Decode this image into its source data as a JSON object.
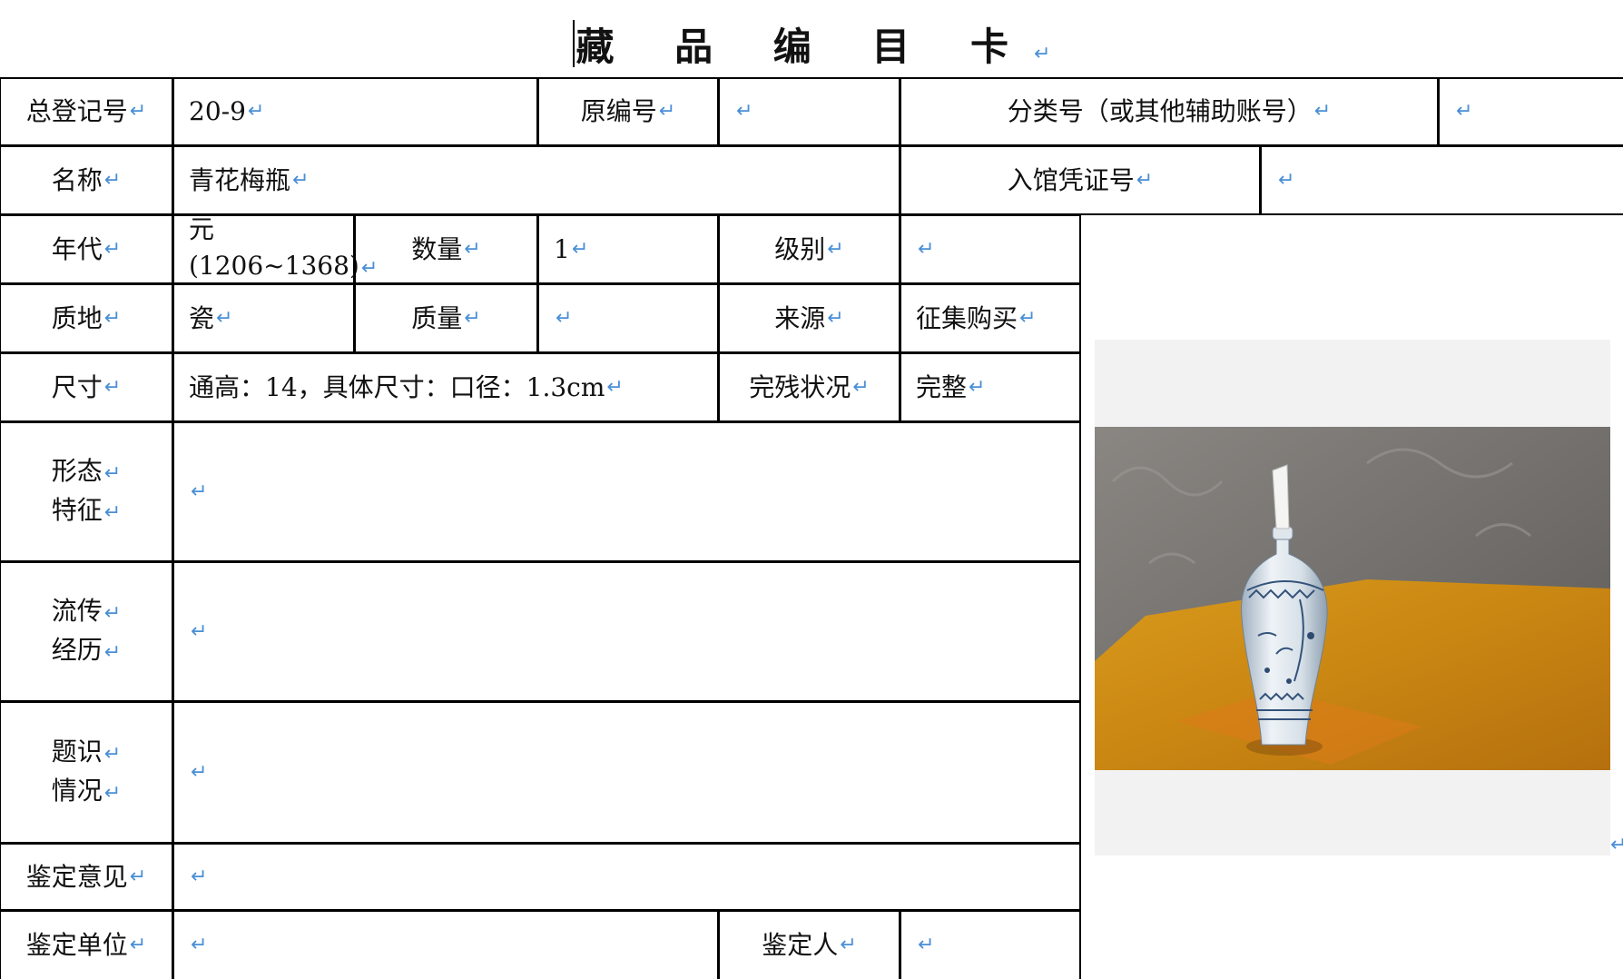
{
  "title": "藏 品 编 目 卡",
  "return_mark": "↵",
  "fields": {
    "total_reg_no": {
      "label": "总登记号",
      "value": "20-9"
    },
    "orig_no": {
      "label": "原编号",
      "value": ""
    },
    "class_no": {
      "label": "分类号（或其他辅助账号）",
      "value": ""
    },
    "name": {
      "label": "名称",
      "value": "青花梅瓶"
    },
    "entry_voucher": {
      "label": "入馆凭证号",
      "value": ""
    },
    "era": {
      "label": "年代",
      "value_line1": "元",
      "value_line2": "(1206~1368)"
    },
    "quantity": {
      "label": "数量",
      "value": "1"
    },
    "grade": {
      "label": "级别",
      "value": ""
    },
    "material": {
      "label": "质地",
      "value": "瓷"
    },
    "mass": {
      "label": "质量",
      "value": ""
    },
    "source": {
      "label": "来源",
      "value": "征集购买"
    },
    "size": {
      "label": "尺寸",
      "value": "通高：14，具体尺寸：口径：1.3cm"
    },
    "condition": {
      "label": "完残状况",
      "value": "完整"
    },
    "form": {
      "label_line1": "形态",
      "label_line2": "特征",
      "value": ""
    },
    "provenance": {
      "label_line1": "流传",
      "label_line2": "经历",
      "value": ""
    },
    "inscription": {
      "label_line1": "题识",
      "label_line2": "情况",
      "value": ""
    },
    "appraisal_opinion": {
      "label": "鉴定意见",
      "value": ""
    },
    "appraisal_unit": {
      "label": "鉴定单位",
      "value": ""
    },
    "appraiser": {
      "label": "鉴定人",
      "value": ""
    }
  },
  "image": {
    "subject": "blue-and-white-meiping-vase-photo"
  },
  "colors": {
    "border": "#000000",
    "return_mark": "#4a8fd6",
    "photo_bg": "#f2f2f2"
  }
}
